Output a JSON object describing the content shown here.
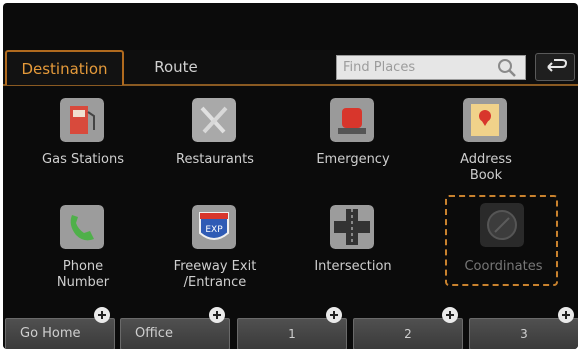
{
  "tabs": {
    "destination": "Destination",
    "route": "Route"
  },
  "search": {
    "placeholder": "Find Places"
  },
  "tiles": [
    {
      "label": "Gas Stations",
      "icon": "gas-pump-icon"
    },
    {
      "label": "Restaurants",
      "icon": "fork-knife-icon"
    },
    {
      "label": "Emergency",
      "icon": "emergency-light-icon"
    },
    {
      "label": "Address\nBook",
      "icon": "address-book-icon"
    },
    {
      "label": "Phone\nNumber",
      "icon": "phone-icon"
    },
    {
      "label": "Freeway Exit\n/Entrance",
      "icon": "freeway-exit-icon"
    },
    {
      "label": "Intersection",
      "icon": "intersection-icon"
    },
    {
      "label": "Coordinates",
      "icon": "coordinates-icon"
    }
  ],
  "quick": [
    {
      "label": "Go Home"
    },
    {
      "label": "Office"
    },
    {
      "label": "1"
    },
    {
      "label": "2"
    },
    {
      "label": "3"
    }
  ],
  "colors": {
    "accent": "#c9822e",
    "text": "#cfcfcf",
    "background": "#0b0b0b"
  }
}
